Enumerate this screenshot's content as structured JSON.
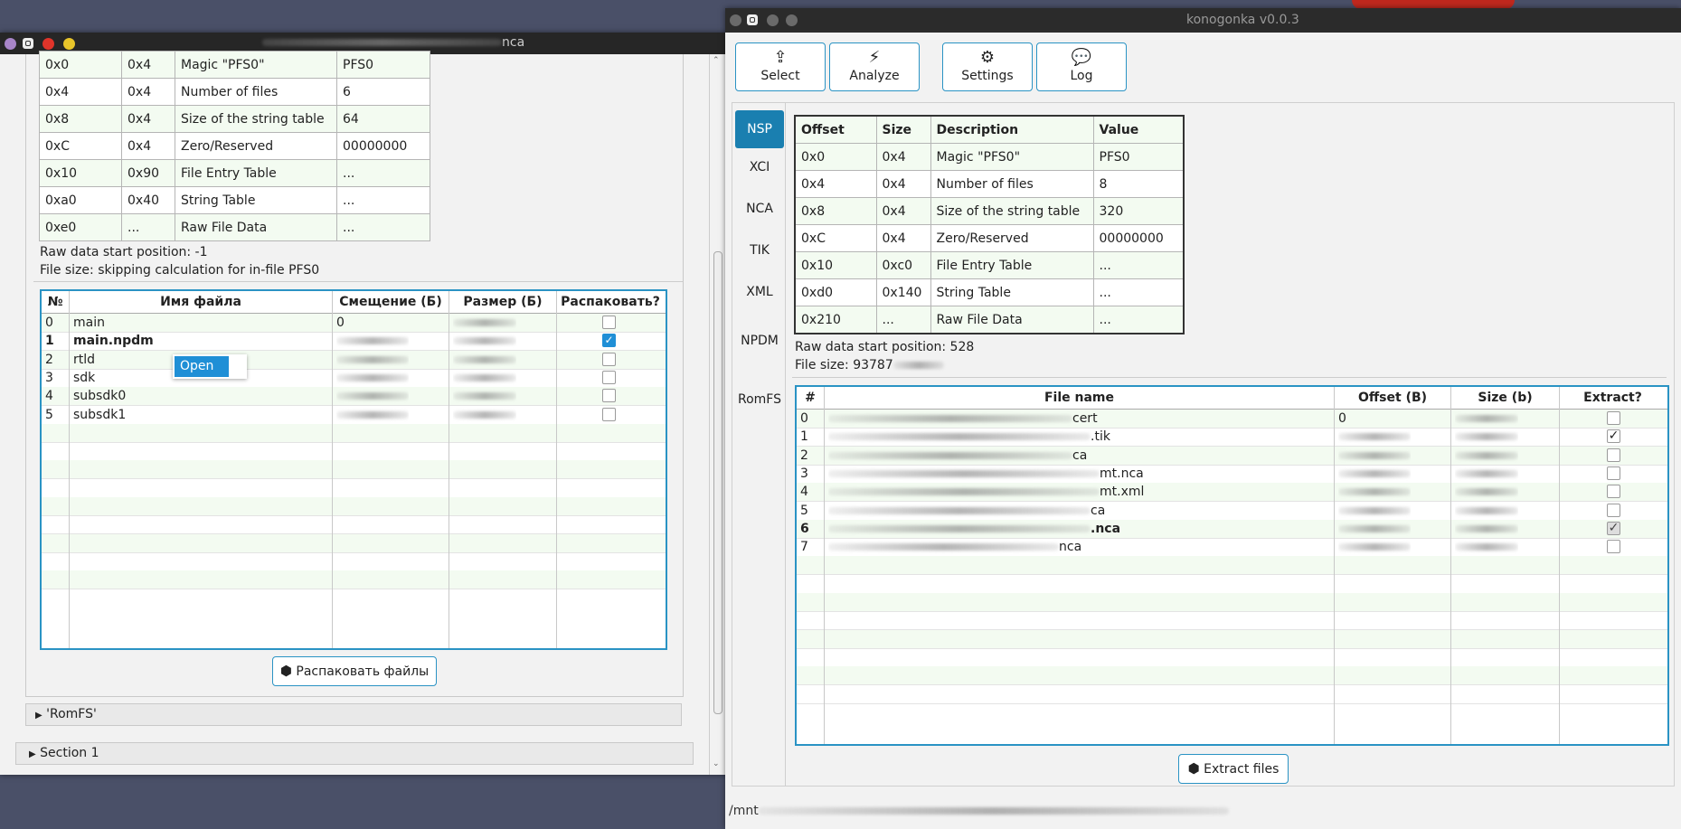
{
  "left": {
    "title_suffix": "nca",
    "header_table": {
      "rows": [
        [
          "0x0",
          "0x4",
          "Magic \"PFS0\"",
          "PFS0"
        ],
        [
          "0x4",
          "0x4",
          "Number of files",
          "6"
        ],
        [
          "0x8",
          "0x4",
          "Size of the string table",
          "64"
        ],
        [
          "0xC",
          "0x4",
          "Zero/Reserved",
          "00000000"
        ],
        [
          "0x10",
          "0x90",
          "File Entry Table",
          "..."
        ],
        [
          "0xa0",
          "0x40",
          "String Table",
          "..."
        ],
        [
          "0xe0",
          "...",
          "Raw File Data",
          "..."
        ]
      ]
    },
    "raw_start": "Raw data start position: -1",
    "file_size": "File size: skipping calculation for in-file PFS0",
    "files": {
      "headers": [
        "№",
        "Имя файла",
        "Смещение (Б)",
        "Размер (Б)",
        "Распаковать?"
      ],
      "rows": [
        {
          "n": "0",
          "name": "main",
          "offset": "0",
          "checked": false
        },
        {
          "n": "1",
          "name": "main.npdm",
          "offset": "",
          "checked": true
        },
        {
          "n": "2",
          "name": "rtld",
          "offset": "",
          "checked": false
        },
        {
          "n": "3",
          "name": "sdk",
          "offset": "",
          "checked": false
        },
        {
          "n": "4",
          "name": "subsdk0",
          "offset": "",
          "checked": false
        },
        {
          "n": "5",
          "name": "subsdk1",
          "offset": "",
          "checked": false
        }
      ]
    },
    "context_menu_item": "Open",
    "extract_button": "Распаковать файлы",
    "romfs_section": "'RomFS'",
    "section1": "Section 1"
  },
  "right": {
    "title": "konogonka v0.0.3",
    "toolbar": {
      "select": "Select",
      "analyze": "Analyze",
      "settings": "Settings",
      "log": "Log"
    },
    "tabs": [
      "NSP",
      "XCI",
      "NCA",
      "TIK",
      "XML",
      "NPDM",
      "RomFS"
    ],
    "header_table": {
      "headers": [
        "Offset",
        "Size",
        "Description",
        "Value"
      ],
      "rows": [
        [
          "0x0",
          "0x4",
          "Magic \"PFS0\"",
          "PFS0"
        ],
        [
          "0x4",
          "0x4",
          "Number of files",
          "8"
        ],
        [
          "0x8",
          "0x4",
          "Size of the string table",
          "320"
        ],
        [
          "0xC",
          "0x4",
          "Zero/Reserved",
          "00000000"
        ],
        [
          "0x10",
          "0xc0",
          "File Entry Table",
          "..."
        ],
        [
          "0xd0",
          "0x140",
          "String Table",
          "..."
        ],
        [
          "0x210",
          "...",
          "Raw File Data",
          "..."
        ]
      ]
    },
    "raw_start": "Raw data start position: 528",
    "file_size": "File size: 93787",
    "files": {
      "headers": [
        "#",
        "File name",
        "Offset (B)",
        "Size (b)",
        "Extract?"
      ],
      "rows": [
        {
          "n": "0",
          "name": "cert",
          "offset": "0",
          "checked": false
        },
        {
          "n": "1",
          "name": ".tik",
          "offset": "",
          "checked": true
        },
        {
          "n": "2",
          "name": "ca",
          "offset": "",
          "checked": false
        },
        {
          "n": "3",
          "name": "mt.nca",
          "offset": "",
          "checked": false
        },
        {
          "n": "4",
          "name": "mt.xml",
          "offset": "",
          "checked": false
        },
        {
          "n": "5",
          "name": "ca",
          "offset": "",
          "checked": false
        },
        {
          "n": "6",
          "name": ".nca",
          "offset": "",
          "checked": true
        },
        {
          "n": "7",
          "name": "nca",
          "offset": "",
          "checked": false
        }
      ]
    },
    "extract_button": "Extract files",
    "status_path": "/mnt"
  },
  "colors": {
    "accent": "#2a93c4",
    "selected_tab": "#1a7fb0",
    "row_alt": "#f3fbf1"
  }
}
